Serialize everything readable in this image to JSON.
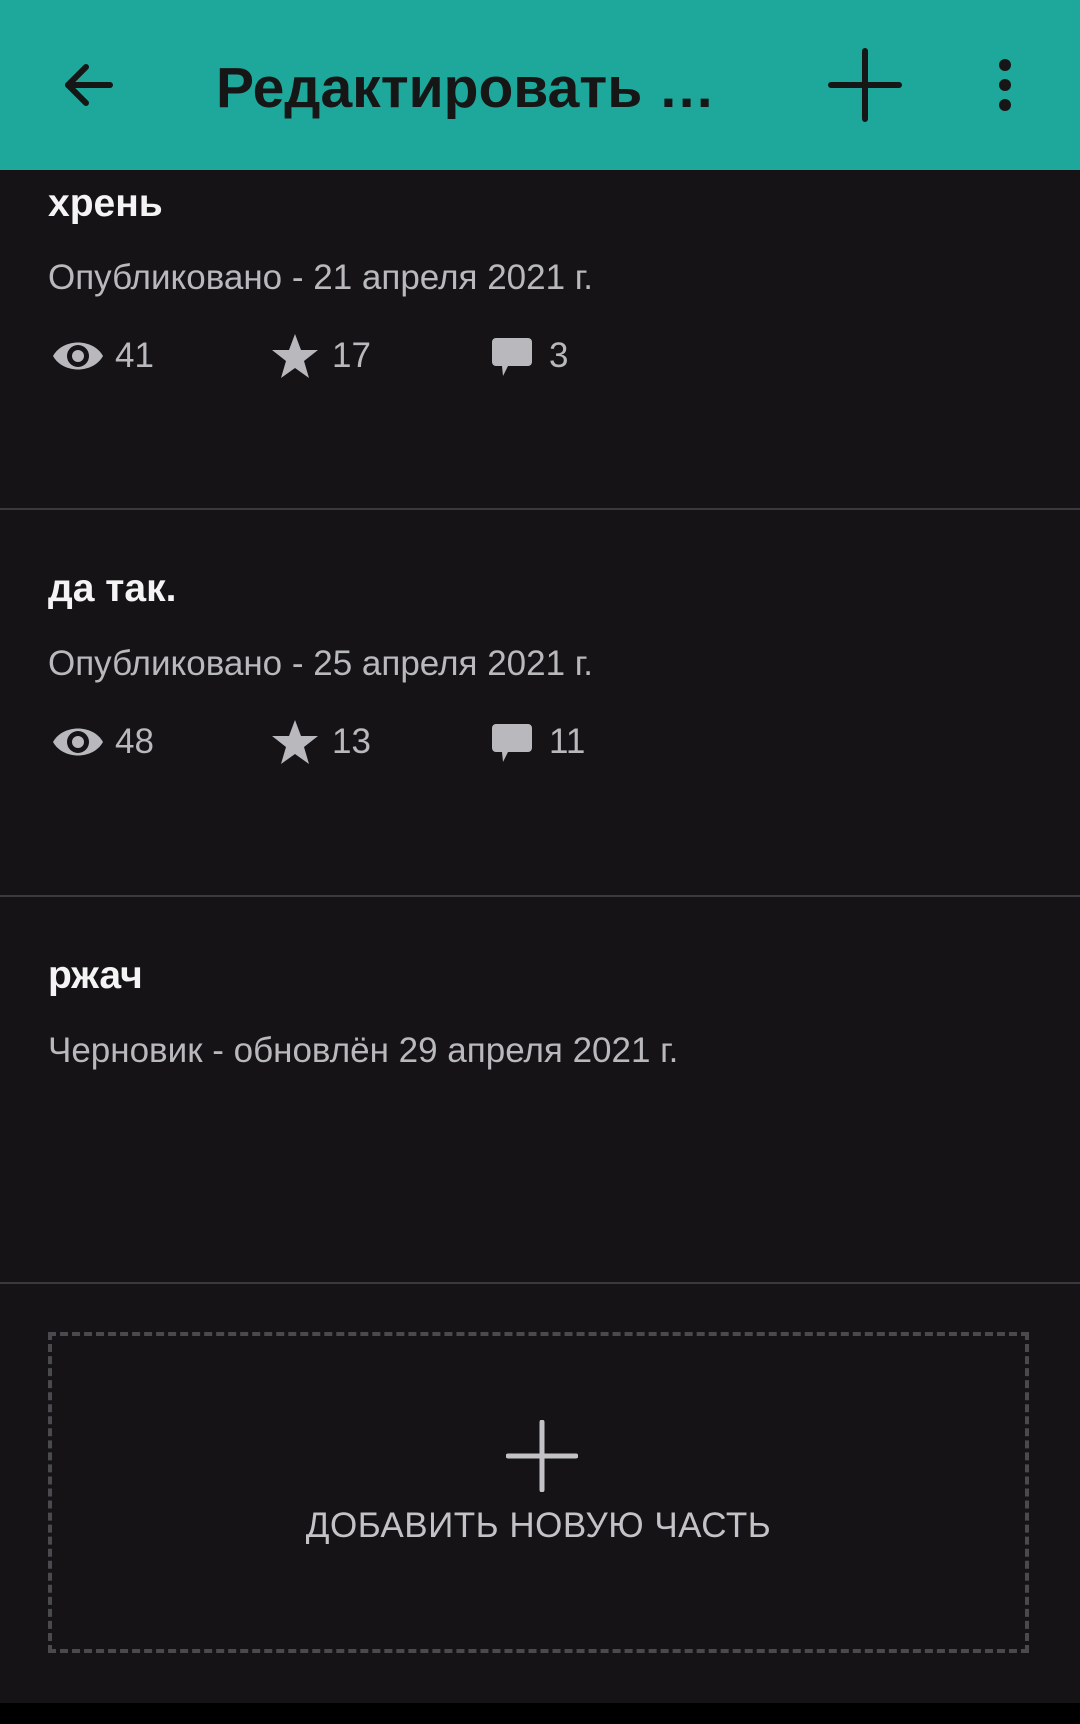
{
  "app_bar": {
    "title": "Редактировать и…",
    "back_icon": "arrow-left-icon",
    "add_icon": "plus-icon",
    "more_icon": "more-vertical-icon",
    "background": "#1ea89c"
  },
  "parts": [
    {
      "title": "хрень",
      "status": "Опубликовано - 21 апреля 2021 г.",
      "views": "41",
      "votes": "17",
      "comments": "3"
    },
    {
      "title": "да так.",
      "status": "Опубликовано - 25 апреля 2021 г.",
      "views": "48",
      "votes": "13",
      "comments": "11"
    },
    {
      "title": "ржач",
      "status": "Черновик - обновлён 29 апреля 2021 г."
    }
  ],
  "stat_icons": {
    "views": "eye-icon",
    "votes": "star-icon",
    "comments": "comment-icon"
  },
  "add_part": {
    "label": "ДОБАВИТЬ НОВУЮ ЧАСТЬ",
    "icon": "plus-icon"
  },
  "colors": {
    "background": "#151316",
    "text_primary": "#f4f4f4",
    "text_secondary": "#b9b9bd",
    "divider": "#3a3a3e"
  }
}
